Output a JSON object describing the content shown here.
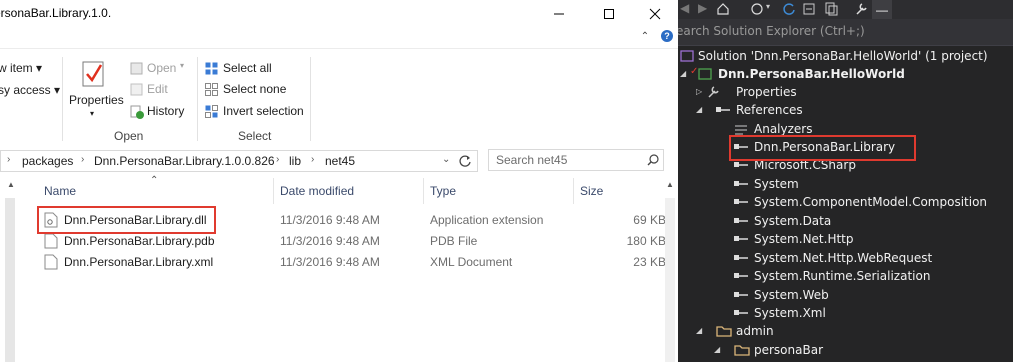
{
  "explorer": {
    "title": "ersonaBar.Library.1.0.",
    "ribbon": {
      "new_item": "w item",
      "easy_access": "sy access",
      "properties": "Properties",
      "open": "Open",
      "edit": "Edit",
      "history": "History",
      "select_all": "Select all",
      "select_none": "Select none",
      "invert_selection": "Invert selection",
      "group_open": "Open",
      "group_select": "Select"
    },
    "breadcrumb": [
      "packages",
      "Dnn.PersonaBar.Library.1.0.0.826",
      "lib",
      "net45"
    ],
    "search_placeholder": "Search net45",
    "columns": {
      "name": "Name",
      "date": "Date modified",
      "type": "Type",
      "size": "Size"
    },
    "files": [
      {
        "name": "Dnn.PersonaBar.Library.dll",
        "date": "11/3/2016 9:48 AM",
        "type": "Application extension",
        "size": "69 KB"
      },
      {
        "name": "Dnn.PersonaBar.Library.pdb",
        "date": "11/3/2016 9:48 AM",
        "type": "PDB File",
        "size": "180 KB"
      },
      {
        "name": "Dnn.PersonaBar.Library.xml",
        "date": "11/3/2016 9:48 AM",
        "type": "XML Document",
        "size": "23 KB"
      }
    ]
  },
  "solution_explorer": {
    "search_placeholder": "earch Solution Explorer (Ctrl+;)",
    "solution": "Solution 'Dnn.PersonaBar.HelloWorld' (1 project)",
    "project": "Dnn.PersonaBar.HelloWorld",
    "properties": "Properties",
    "references": "References",
    "refs": [
      "Analyzers",
      "Dnn.PersonaBar.Library",
      "Microsoft.CSharp",
      "System",
      "System.ComponentModel.Composition",
      "System.Data",
      "System.Net.Http",
      "System.Net.Http.WebRequest",
      "System.Runtime.Serialization",
      "System.Web",
      "System.Xml"
    ],
    "folders": [
      "admin",
      "personaBar"
    ]
  },
  "colors": {
    "highlight": "#e03a2f",
    "vs_background": "#252526",
    "accent_blue": "#2b6cc4"
  }
}
